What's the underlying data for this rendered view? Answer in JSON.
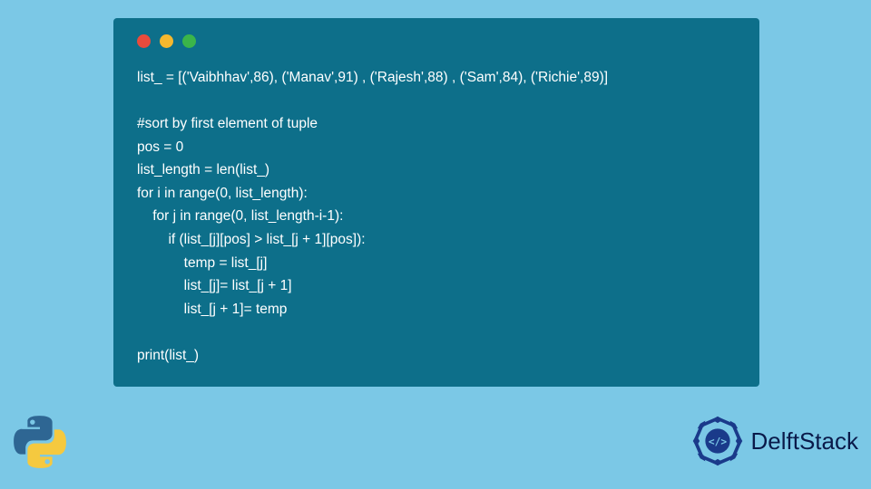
{
  "code": {
    "lines": [
      "list_ = [('Vaibhhav',86), ('Manav',91) , ('Rajesh',88) , ('Sam',84), ('Richie',89)]",
      "",
      "#sort by first element of tuple",
      "pos = 0",
      "list_length = len(list_)",
      "for i in range(0, list_length):",
      "    for j in range(0, list_length-i-1):",
      "        if (list_[j][pos] > list_[j + 1][pos]):",
      "            temp = list_[j]",
      "            list_[j]= list_[j + 1]",
      "            list_[j + 1]= temp",
      "",
      "print(list_)"
    ]
  },
  "brand": {
    "name": "DelftStack"
  },
  "colors": {
    "background": "#7bc8e6",
    "window": "#0d6f8a",
    "text": "#ffffff",
    "brandText": "#0a1a4a"
  }
}
